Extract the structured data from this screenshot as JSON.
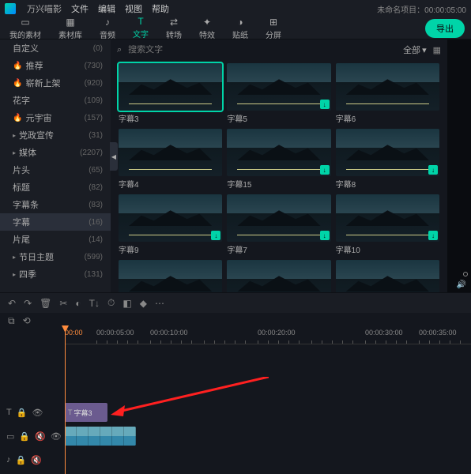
{
  "app": {
    "name": "万兴喵影"
  },
  "menu": [
    "文件",
    "编辑",
    "视图",
    "帮助"
  ],
  "project": {
    "label": "未命名项目：00:00:05:00"
  },
  "tabs": [
    {
      "icon": "▭",
      "label": "我的素材"
    },
    {
      "icon": "▦",
      "label": "素材库"
    },
    {
      "icon": "♪",
      "label": "音频"
    },
    {
      "icon": "T",
      "label": "文字",
      "active": true
    },
    {
      "icon": "⇄",
      "label": "转场"
    },
    {
      "icon": "✦",
      "label": "特效"
    },
    {
      "icon": "◑",
      "label": "贴纸"
    },
    {
      "icon": "⊞",
      "label": "分屏"
    }
  ],
  "export_label": "导出",
  "sidebar": [
    {
      "name": "自定义",
      "cnt": "(0)"
    },
    {
      "name": "推荐",
      "cnt": "(730)",
      "fire": true
    },
    {
      "name": "崭新上架",
      "cnt": "(920)",
      "fire": true
    },
    {
      "name": "花字",
      "cnt": "(109)"
    },
    {
      "name": "元宇宙",
      "cnt": "(157)",
      "fire": true
    },
    {
      "name": "党政宣传",
      "cnt": "(31)",
      "arrow": true
    },
    {
      "name": "媒体",
      "cnt": "(2207)",
      "arrow": true
    },
    {
      "name": "片头",
      "cnt": "(65)"
    },
    {
      "name": "标题",
      "cnt": "(82)"
    },
    {
      "name": "字幕条",
      "cnt": "(83)"
    },
    {
      "name": "字幕",
      "cnt": "(16)",
      "sel": true
    },
    {
      "name": "片尾",
      "cnt": "(14)"
    },
    {
      "name": "节日主题",
      "cnt": "(599)",
      "arrow": true
    },
    {
      "name": "四季",
      "cnt": "(131)",
      "arrow": true
    }
  ],
  "search": {
    "placeholder": "搜索文字"
  },
  "filter": {
    "label": "全部"
  },
  "thumbs": [
    {
      "name": "字幕3",
      "sel": true,
      "dl": false
    },
    {
      "name": "字幕5",
      "dl": true
    },
    {
      "name": "字幕6",
      "dl": false
    },
    {
      "name": "字幕4",
      "dl": false
    },
    {
      "name": "字幕15",
      "dl": true
    },
    {
      "name": "字幕8",
      "dl": true
    },
    {
      "name": "字幕9",
      "dl": true
    },
    {
      "name": "字幕7",
      "dl": true
    },
    {
      "name": "字幕10",
      "dl": true
    },
    {
      "name": "",
      "dl": false
    },
    {
      "name": "",
      "dl": false
    },
    {
      "name": "",
      "dl": false
    }
  ],
  "ruler": {
    "start": "00:00",
    "marks": [
      "00:00:05:00",
      "00:00:10:00",
      "",
      "00:00:20:00",
      "",
      "00:00:30:00",
      "00:00:35:00"
    ]
  },
  "timeline": {
    "text_clip_label": "字幕3"
  }
}
